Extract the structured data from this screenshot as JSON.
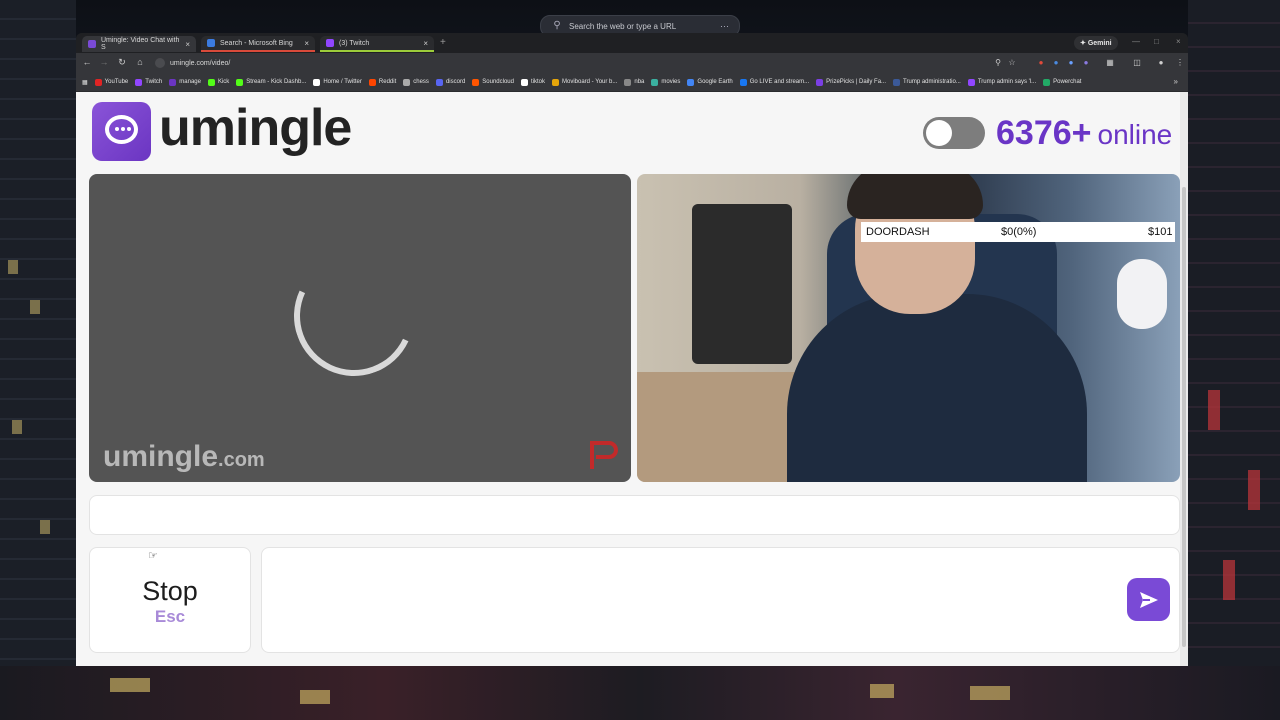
{
  "system": {
    "search_placeholder": "Search the web or type a URL"
  },
  "browser": {
    "tabs": [
      {
        "label": "Umingle: Video Chat with S",
        "active": true,
        "accent": "#7a4ad6"
      },
      {
        "label": "Search - Microsoft Bing",
        "active": false,
        "accent": "#d94a3a"
      },
      {
        "label": "(3) Twitch",
        "active": false,
        "accent": "#9ccc3a"
      }
    ],
    "gemini_label": "Gemini",
    "url": "umingle.com/video/",
    "bookmarks": [
      "YouTube",
      "Twitch",
      "manage",
      "Kick",
      "Stream - Kick Dashb...",
      "Home / Twitter",
      "Reddit",
      "chess",
      "discord",
      "Soundcloud",
      "tiktok",
      "Moviboard - Your b...",
      "nba",
      "movies",
      "Google Earth",
      "Go LIVE and stream...",
      "PrizePicks | Daily Fa...",
      "Trump administratio...",
      "Trump admin says 'l...",
      "Powerchat"
    ],
    "bookmark_colors": [
      "#e02424",
      "#9146ff",
      "#6b35c2",
      "#53fc18",
      "#53fc18",
      "#ffffff",
      "#ff4500",
      "#aaaaaa",
      "#5865f2",
      "#ff5500",
      "#ffffff",
      "#e5a50a",
      "#888888",
      "#3ab0a0",
      "#4285f4",
      "#1877f2",
      "#7b3fe4",
      "#3b5998",
      "#9146ff",
      "#22aa66"
    ]
  },
  "page": {
    "brand": "umingle",
    "online_count": "6376+",
    "online_label": "online",
    "toggle_on": false,
    "watermark_name": "umingle",
    "watermark_domain": ".com",
    "stock_overlay": {
      "ticker": "DOORDASH",
      "change": "$0(0%)",
      "price": "$101"
    },
    "stop_label": "Stop",
    "stop_hint": "Esc",
    "message_placeholder": ""
  },
  "colors": {
    "accent": "#7a4ad6",
    "online_text": "#6a35c6",
    "flag": "#c22a2a"
  },
  "icons": [
    "chat-bubble-icon",
    "loading-spinner-icon",
    "flag-icon",
    "send-icon"
  ]
}
